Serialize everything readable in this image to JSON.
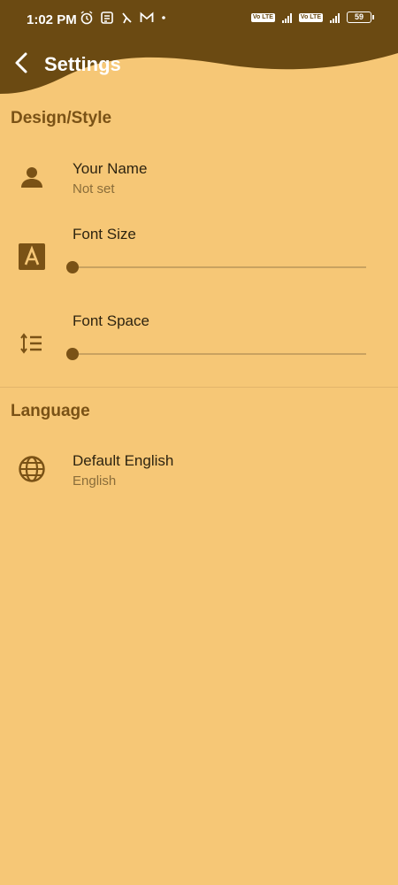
{
  "status_bar": {
    "time": "1:02 PM",
    "left_icons": [
      "alarm-icon",
      "notes-icon",
      "moon-icon",
      "gmail-icon",
      "dot-icon"
    ],
    "sim1_label": "Vo LTE",
    "sim2_label": "Vo LTE",
    "battery": "59"
  },
  "header": {
    "title": "Settings",
    "back_icon": "chevron-left-icon",
    "header_color": "#6b4a12",
    "background_color": "#f6c776"
  },
  "sections": {
    "design": {
      "title": "Design/Style",
      "your_name": {
        "title": "Your Name",
        "value": "Not set",
        "icon": "person-icon"
      },
      "font_size": {
        "title": "Font Size",
        "icon": "font-a-icon",
        "value": 0
      },
      "font_space": {
        "title": "Font Space",
        "icon": "line-spacing-icon",
        "value": 0
      }
    },
    "language": {
      "title": "Language",
      "default": {
        "title": "Default English",
        "value": "English",
        "icon": "globe-icon"
      }
    }
  },
  "accent_color": "#7a5216"
}
